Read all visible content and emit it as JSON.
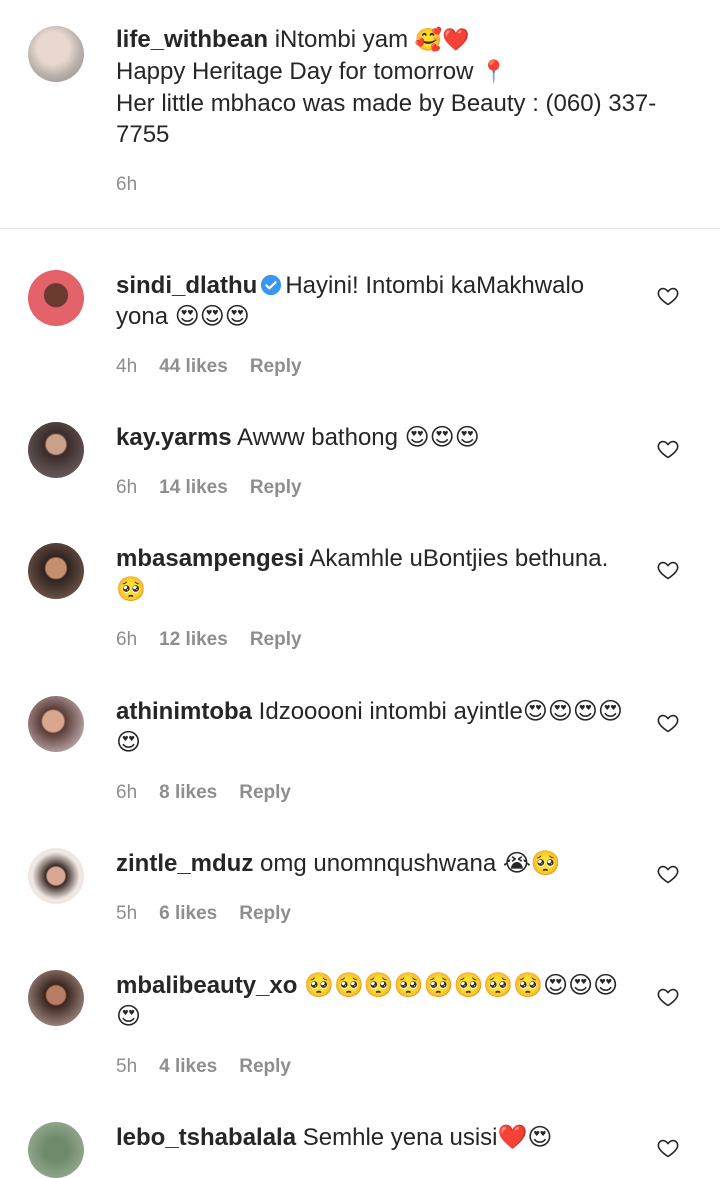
{
  "caption": {
    "username": "life_withbean",
    "line1": "iNtombi yam",
    "line1_emoji": "🥰❤️",
    "line2": "Happy Heritage Day for tomorrow",
    "line2_emoji": "📍",
    "line3": "Her little mbhaco was made by Beauty : (060) 337-7755",
    "time": "6h"
  },
  "comments": [
    {
      "username": "sindi_dlathu",
      "verified": true,
      "text": "Hayini! Intombi kaMakhwalo yona 😍😍😍",
      "time": "4h",
      "likes": "44 likes",
      "reply": "Reply"
    },
    {
      "username": "kay.yarms",
      "verified": false,
      "text": "Awww bathong 😍😍😍",
      "time": "6h",
      "likes": "14 likes",
      "reply": "Reply"
    },
    {
      "username": "mbasampengesi",
      "verified": false,
      "text": "Akamhle uBontjies bethuna. 🥺",
      "time": "6h",
      "likes": "12 likes",
      "reply": "Reply"
    },
    {
      "username": "athinimtoba",
      "verified": false,
      "text": "Idzooooni intombi ayintle😍😍😍😍😍",
      "time": "6h",
      "likes": "8 likes",
      "reply": "Reply"
    },
    {
      "username": "zintle_mduz",
      "verified": false,
      "text": "omg unomnqushwana 😭🥺",
      "time": "5h",
      "likes": "6 likes",
      "reply": "Reply"
    },
    {
      "username": "mbalibeauty_xo",
      "verified": false,
      "text": "🥺🥺🥺🥺🥺🥺🥺🥺😍😍😍😍",
      "time": "5h",
      "likes": "4 likes",
      "reply": "Reply"
    },
    {
      "username": "lebo_tshabalala",
      "verified": false,
      "text": "Semhle yena usisi❤️😍",
      "time": "",
      "likes": "",
      "reply": ""
    }
  ],
  "icons": {
    "like": "heart-outline-icon",
    "verified": "verified-badge-icon"
  },
  "colors": {
    "text": "#262626",
    "muted": "#8e8e8e",
    "verified": "#3897f0",
    "divider": "#e4e4e4"
  }
}
